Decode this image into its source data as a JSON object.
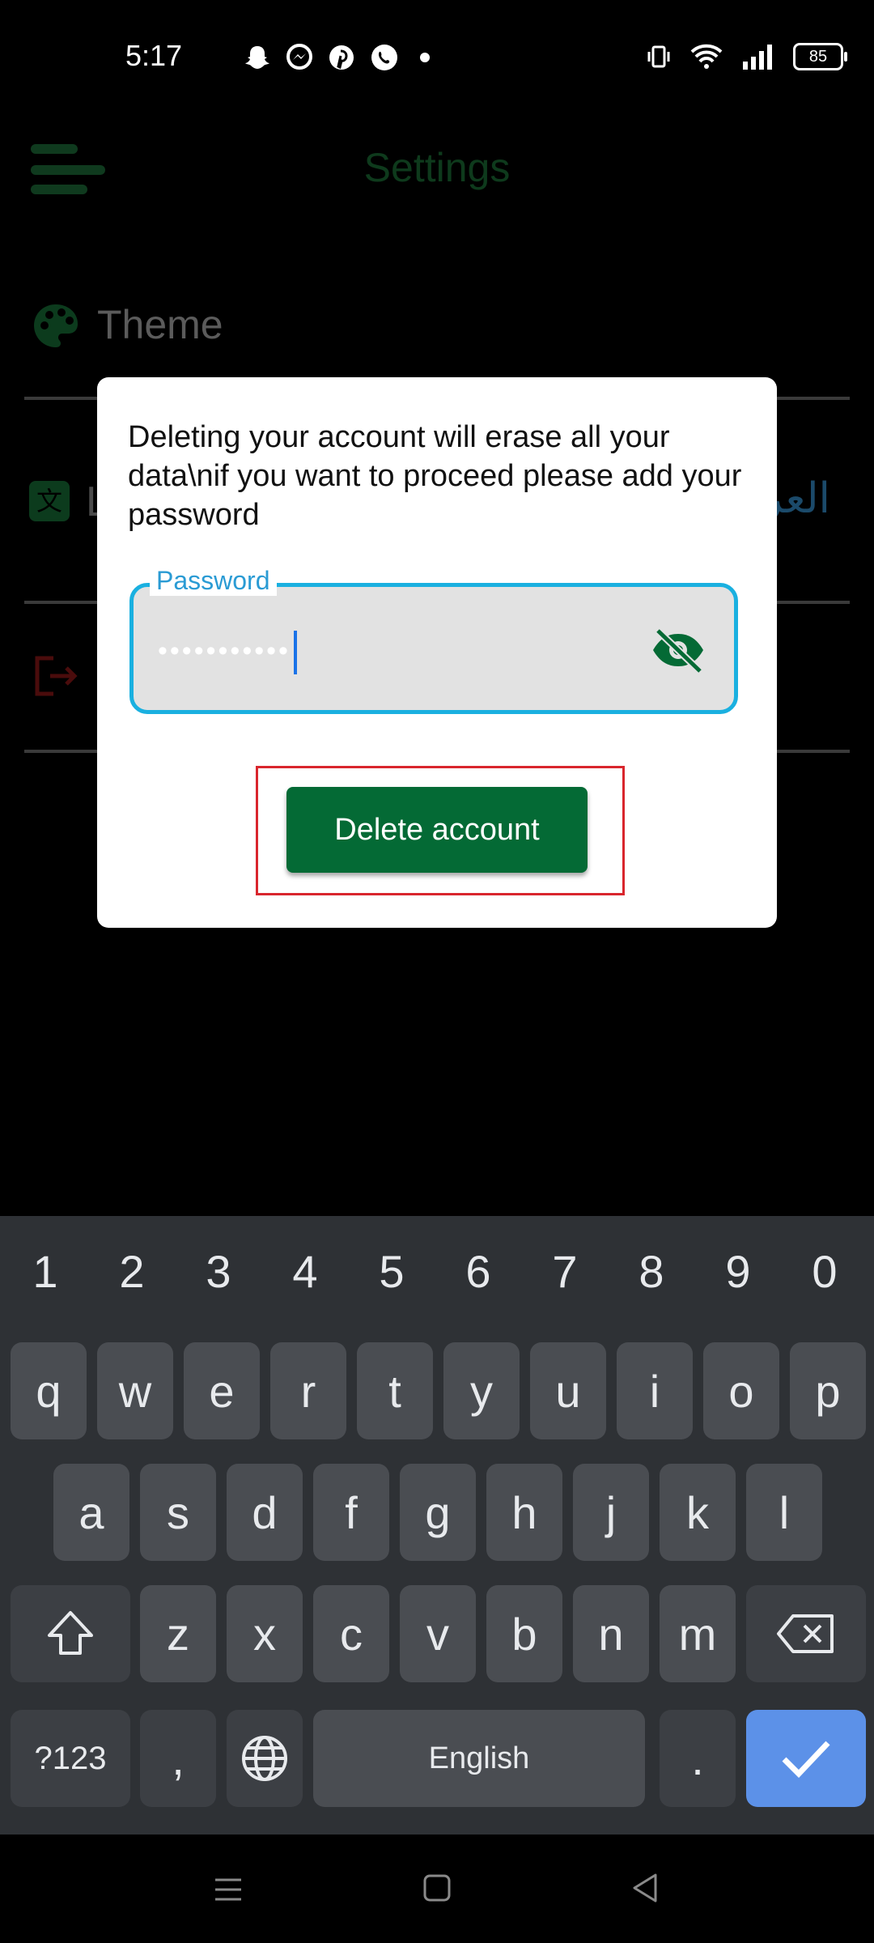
{
  "status_bar": {
    "time": "5:17",
    "battery": "85",
    "left_icons": [
      "snapchat-icon",
      "messenger-icon",
      "pinterest-icon",
      "whatsapp-icon",
      "dot-icon"
    ],
    "right_icons": [
      "vibrate-icon",
      "wifi-icon",
      "signal-icon",
      "battery-icon"
    ]
  },
  "settings": {
    "title": "Settings",
    "items": [
      {
        "label": "Theme",
        "icon": "palette-icon"
      },
      {
        "label": "L",
        "icon": "translate-icon",
        "value": "العربية"
      },
      {
        "label": "",
        "icon": "logout-icon"
      }
    ]
  },
  "dialog": {
    "message": "Deleting your account will erase all your data\\nif you want to proceed please add your password",
    "password_label": "Password",
    "password_value": "•••••••••••",
    "delete_button": "Delete account",
    "accent": "#1ab0e0",
    "button_color": "#046a35"
  },
  "keyboard": {
    "numbers": [
      "1",
      "2",
      "3",
      "4",
      "5",
      "6",
      "7",
      "8",
      "9",
      "0"
    ],
    "row1": [
      "q",
      "w",
      "e",
      "r",
      "t",
      "y",
      "u",
      "i",
      "o",
      "p"
    ],
    "row2": [
      "a",
      "s",
      "d",
      "f",
      "g",
      "h",
      "j",
      "k",
      "l"
    ],
    "row3": [
      "z",
      "x",
      "c",
      "v",
      "b",
      "n",
      "m"
    ],
    "symbols_key": "?123",
    "comma_key": ",",
    "space_key": "English",
    "period_key": "."
  }
}
